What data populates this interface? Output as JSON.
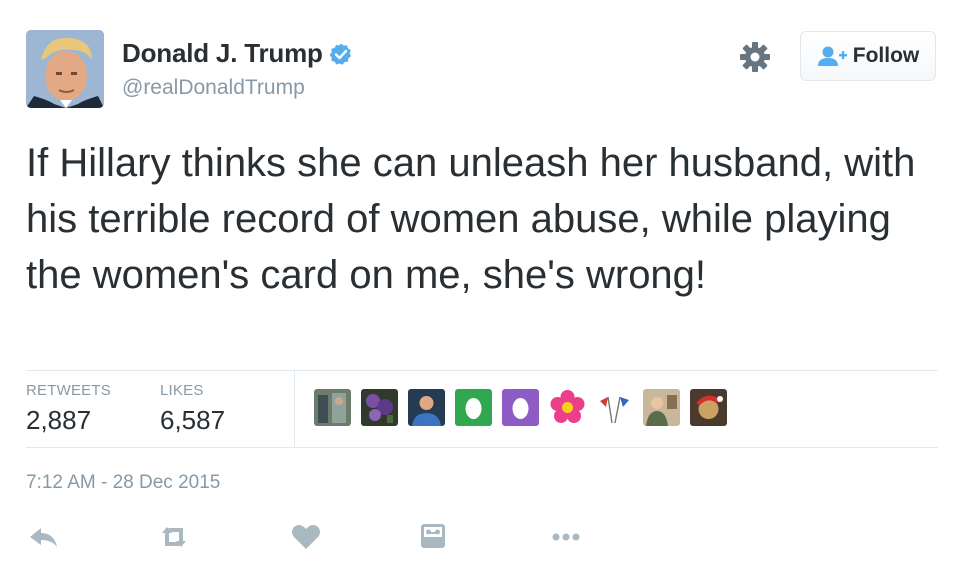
{
  "user": {
    "display_name": "Donald J. Trump",
    "handle": "@realDonaldTrump",
    "verified": true,
    "avatar_icon": "profile-photo"
  },
  "header": {
    "settings_icon": "gear-icon",
    "follow_label": "Follow",
    "follow_icon": "add-user-icon"
  },
  "tweet": {
    "text": "If Hillary thinks she can unleash her husband, with his terrible record of women abuse, while playing the women's card on me, she's wrong!"
  },
  "stats": {
    "retweets_label": "RETWEETS",
    "retweets_value": "2,887",
    "likes_label": "LIKES",
    "likes_value": "6,587"
  },
  "likers": [
    {
      "icon": "liker-avatar-1"
    },
    {
      "icon": "liker-avatar-2"
    },
    {
      "icon": "liker-avatar-3"
    },
    {
      "icon": "liker-avatar-egg-green"
    },
    {
      "icon": "liker-avatar-egg-purple"
    },
    {
      "icon": "liker-avatar-flower"
    },
    {
      "icon": "liker-avatar-flags"
    },
    {
      "icon": "liker-avatar-8"
    },
    {
      "icon": "liker-avatar-9"
    }
  ],
  "timestamp": "7:12 AM - 28 Dec 2015",
  "actions": [
    "reply-icon",
    "retweet-icon",
    "like-icon",
    "view-activity-icon",
    "more-icon"
  ],
  "colors": {
    "text": "#292f33",
    "muted": "#8899a6",
    "verified": "#55acee",
    "divider": "#e1e8ed",
    "action": "#aab8c2"
  }
}
